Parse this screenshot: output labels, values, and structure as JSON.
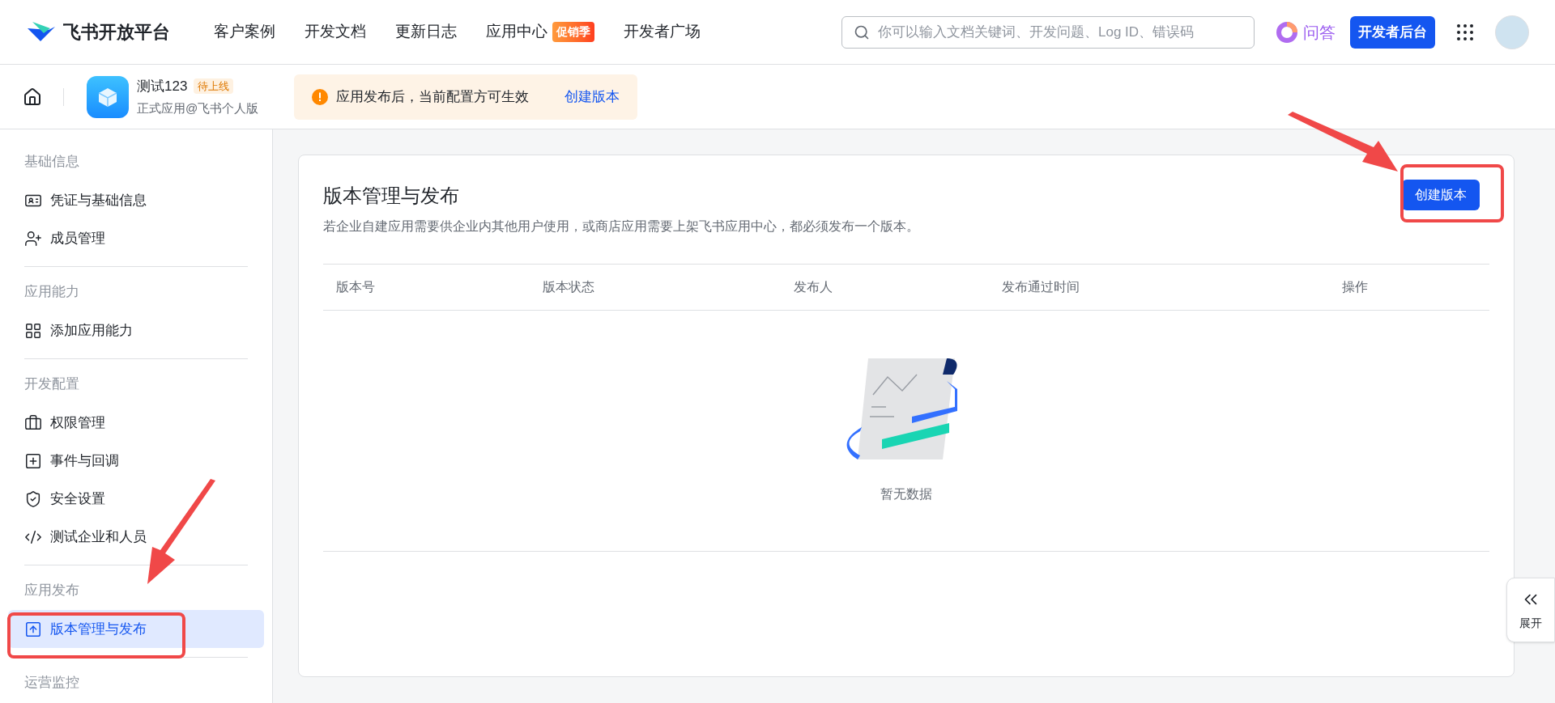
{
  "header": {
    "logo_text": "飞书开放平台",
    "nav": [
      {
        "label": "客户案例"
      },
      {
        "label": "开发文档"
      },
      {
        "label": "更新日志"
      },
      {
        "label": "应用中心",
        "badge": "促销季"
      },
      {
        "label": "开发者广场"
      }
    ],
    "search": {
      "placeholder": "你可以输入文档关键词、开发问题、Log ID、错误码"
    },
    "ai_label": "问答",
    "console_button": "开发者后台"
  },
  "app_bar": {
    "app_name": "测试123",
    "status_badge": "待上线",
    "app_type": "正式应用@飞书个人版",
    "notice": {
      "text": "应用发布后，当前配置方可生效",
      "link": "创建版本"
    }
  },
  "sidebar": {
    "groups": [
      {
        "title": "基础信息",
        "items": [
          {
            "label": "凭证与基础信息",
            "selected": false
          },
          {
            "label": "成员管理",
            "selected": false
          }
        ]
      },
      {
        "title": "应用能力",
        "items": [
          {
            "label": "添加应用能力",
            "selected": false
          }
        ]
      },
      {
        "title": "开发配置",
        "items": [
          {
            "label": "权限管理",
            "selected": false
          },
          {
            "label": "事件与回调",
            "selected": false
          },
          {
            "label": "安全设置",
            "selected": false
          },
          {
            "label": "测试企业和人员",
            "selected": false
          }
        ]
      },
      {
        "title": "应用发布",
        "items": [
          {
            "label": "版本管理与发布",
            "selected": true
          }
        ]
      },
      {
        "title": "运营监控"
      }
    ]
  },
  "main": {
    "title": "版本管理与发布",
    "description": "若企业自建应用需要供企业内其他用户使用，或商店应用需要上架飞书应用中心，都必须发布一个版本。",
    "create_button": "创建版本",
    "table": {
      "columns": [
        "版本号",
        "版本状态",
        "发布人",
        "发布通过时间",
        "操作"
      ],
      "empty_text": "暂无数据"
    }
  },
  "expand_tab": {
    "label": "展开"
  }
}
